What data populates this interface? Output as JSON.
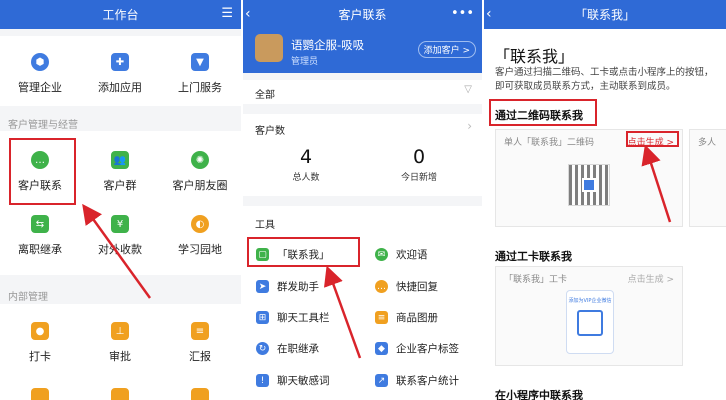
{
  "workbench": {
    "title": "工作台",
    "top_apps": [
      "管理企业",
      "添加应用",
      "上门服务"
    ],
    "section_customer": "客户管理与经营",
    "customer_apps": [
      "客户联系",
      "客户群",
      "客户朋友圈",
      "离职继承",
      "对外收款",
      "学习园地"
    ],
    "section_internal": "内部管理",
    "internal_apps": [
      "打卡",
      "审批",
      "汇报"
    ]
  },
  "contact": {
    "title": "客户联系",
    "user_name": "语鹦企服-吸吸",
    "user_role": "管理员",
    "add_customer": "添加客户 >",
    "filter_label": "全部",
    "customer_count_label": "客户数",
    "stats": [
      {
        "value": "4",
        "label": "总人数"
      },
      {
        "value": "0",
        "label": "今日新增"
      }
    ],
    "tools_label": "工具",
    "tools": [
      {
        "label": "「联系我」",
        "color": "#3fb24a"
      },
      {
        "label": "欢迎语",
        "color": "#3fb24a"
      },
      {
        "label": "群发助手",
        "color": "#3f7be0"
      },
      {
        "label": "快捷回复",
        "color": "#f0a020"
      },
      {
        "label": "聊天工具栏",
        "color": "#3f7be0"
      },
      {
        "label": "商品图册",
        "color": "#f0a020"
      },
      {
        "label": "在职继承",
        "color": "#3f7be0"
      },
      {
        "label": "企业客户标签",
        "color": "#3f7be0"
      },
      {
        "label": "聊天敏感词",
        "color": "#3f7be0"
      },
      {
        "label": "联系客户统计",
        "color": "#3f7be0"
      }
    ]
  },
  "contactme": {
    "title": "「联系我」",
    "heading": "「联系我」",
    "desc": "客户通过扫描二维码、工卡或点击小程序上的按钮，即可获取成员联系方式，主动联系到成员。",
    "qr_heading": "通过二维码联系我",
    "single_qr": "单人「联系我」二维码",
    "multi_qr": "多人",
    "generate": "点击生成 >",
    "card_heading": "通过工卡联系我",
    "card_label": "「联系我」工卡",
    "card_generate": "点击生成 >",
    "card_inner": "添加为VIP企业微信",
    "miniprogram_heading": "在小程序中联系我"
  },
  "colors": {
    "header": "#2f6ad6",
    "red": "#d9242b",
    "link": "#2f6ad6"
  }
}
